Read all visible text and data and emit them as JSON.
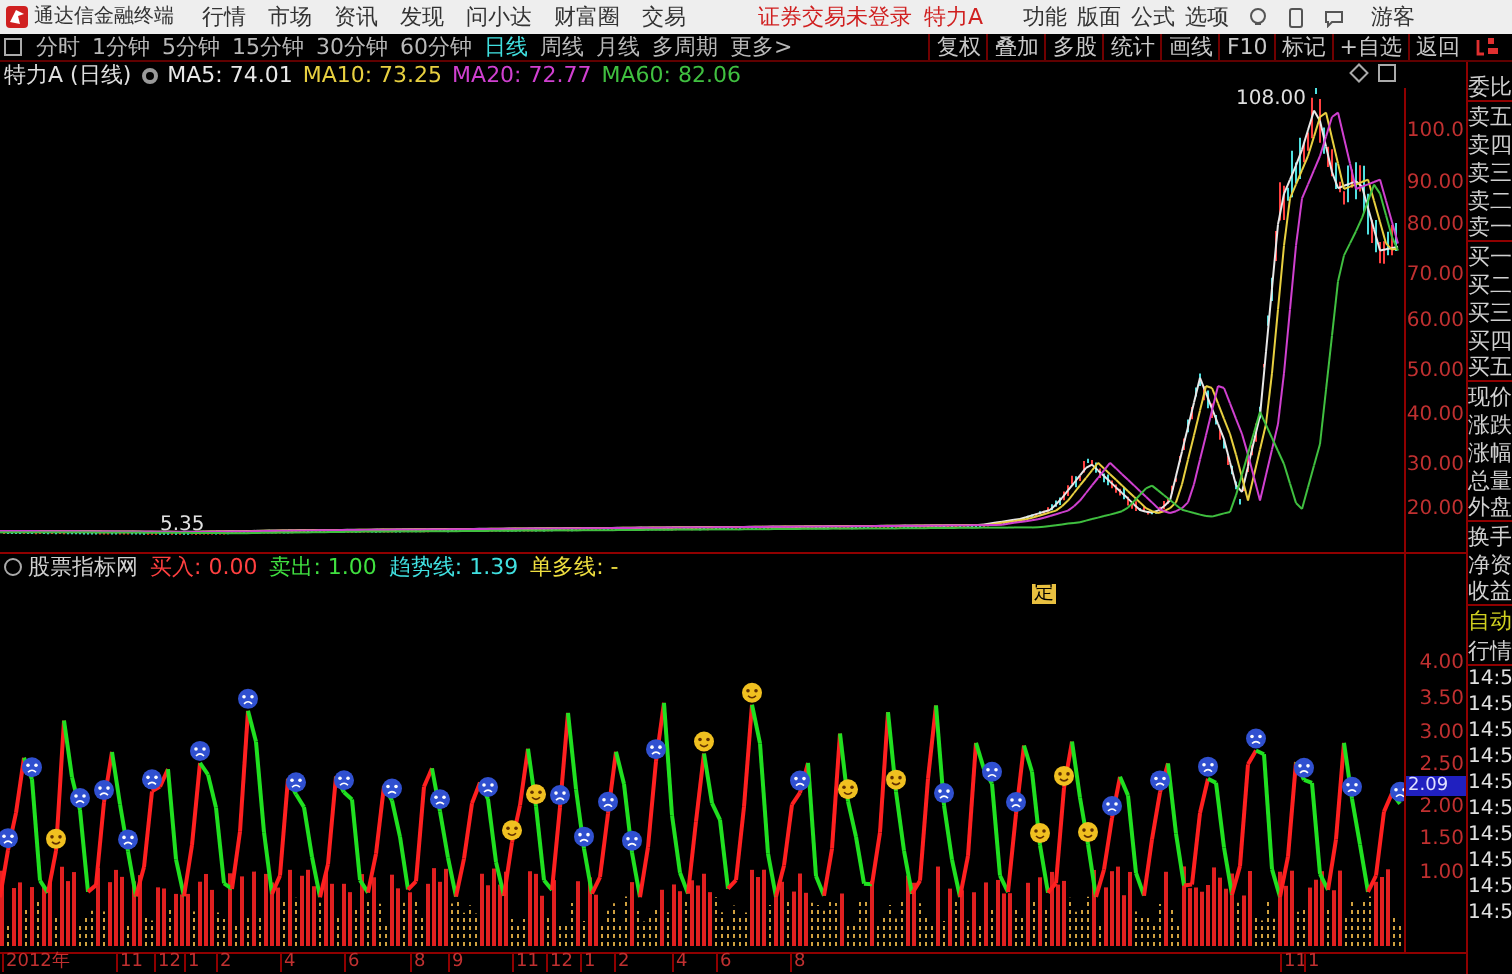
{
  "app_bar": {
    "title": "通达信金融终端",
    "menus": [
      "行情",
      "市场",
      "资讯",
      "发现",
      "问小达",
      "财富圈",
      "交易"
    ],
    "login_status": "证券交易未登录",
    "stock": "特力A",
    "tools": [
      "功能",
      "版面",
      "公式",
      "选项"
    ],
    "user": "游客"
  },
  "toolbar": {
    "periods": [
      {
        "label": "分时",
        "selected": false
      },
      {
        "label": "1分钟",
        "selected": false
      },
      {
        "label": "5分钟",
        "selected": false
      },
      {
        "label": "15分钟",
        "selected": false
      },
      {
        "label": "30分钟",
        "selected": false
      },
      {
        "label": "60分钟",
        "selected": false
      },
      {
        "label": "日线",
        "selected": true
      },
      {
        "label": "周线",
        "selected": false
      },
      {
        "label": "月线",
        "selected": false
      },
      {
        "label": "多周期",
        "selected": false
      },
      {
        "label": "更多>",
        "selected": false
      }
    ],
    "actions": [
      "复权",
      "叠加",
      "多股",
      "统计",
      "画线",
      "F10",
      "标记",
      "+自选",
      "返回"
    ]
  },
  "price_chart": {
    "title": "特力A (日线)",
    "indicators": [
      {
        "label": "MA5: 74.01",
        "color": "#e8e8e8"
      },
      {
        "label": "MA10: 73.25",
        "color": "#e8d040"
      },
      {
        "label": "MA20: 72.77",
        "color": "#d040d0"
      },
      {
        "label": "MA60: 82.06",
        "color": "#40c040"
      }
    ],
    "y_labels": [
      "100.0",
      "90.00",
      "80.00",
      "70.00",
      "60.00",
      "50.00",
      "40.00",
      "30.00",
      "20.00"
    ],
    "high_label": "108.00",
    "low_label": "5.35"
  },
  "indicator_chart": {
    "title": "股票指标网",
    "marker": "定",
    "values": [
      {
        "label": "买入: 0.00",
        "color": "#ff4040"
      },
      {
        "label": "卖出: 1.00",
        "color": "#40e040"
      },
      {
        "label": "趋势线: 1.39",
        "color": "#40e0e0"
      },
      {
        "label": "单多线: -",
        "color": "#f0e040"
      }
    ],
    "y_labels": [
      "4.00",
      "3.50",
      "3.00",
      "2.50",
      "2.00",
      "1.50",
      "1.00"
    ],
    "current_value": "2.09"
  },
  "x_axis": {
    "labels": [
      "2012年",
      "11",
      "12",
      "1",
      "2",
      "4",
      "6",
      "8",
      "9",
      "11",
      "12",
      "1",
      "2",
      "4",
      "6",
      "8",
      "11",
      "1"
    ]
  },
  "quote_panel": {
    "fields": [
      "委比",
      "卖五",
      "卖四",
      "卖三",
      "卖二",
      "卖一",
      "买一",
      "买二",
      "买三",
      "买四",
      "买五",
      "现价",
      "涨跌",
      "涨幅",
      "总量",
      "外盘",
      "换手",
      "净资",
      "收益"
    ],
    "mode": "自动",
    "section": "行情",
    "trades": [
      "14:5",
      "14:5",
      "14:5",
      "14:5",
      "14:5",
      "14:5",
      "14:5",
      "14:5",
      "14:5",
      "14:5"
    ]
  }
}
